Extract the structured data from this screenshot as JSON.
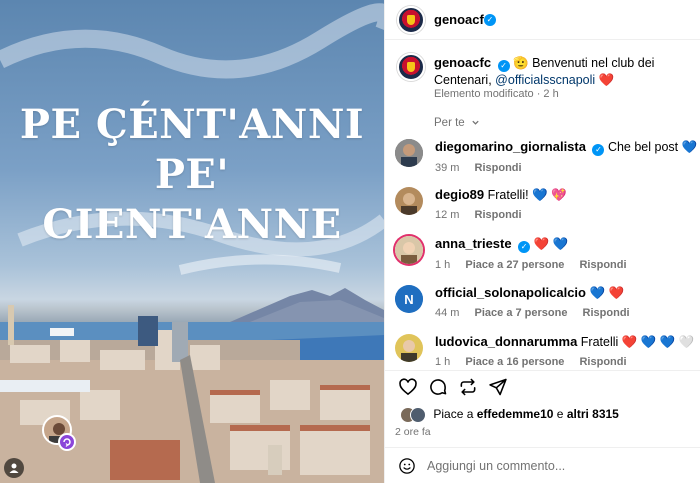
{
  "post": {
    "headline_line1": "PE ÇÉNT'ANNI",
    "headline_line2": "PE' CIENT'ANNE",
    "colors": {
      "accent_purple": "#8b45d9",
      "verified": "#0095f6"
    }
  },
  "header": {
    "username": "genoacfc",
    "verified_icon": "verified-badge-icon"
  },
  "caption": {
    "username": "genoacfc",
    "emoji": "🫡",
    "text": "Benvenuti nel club dei Centenari,",
    "mention": "@officialsscnapoli",
    "emoji_end": "❤️",
    "meta": "Elemento modificato · 2 h"
  },
  "sort": {
    "label": "Per te",
    "chevron": "chevron-down-icon"
  },
  "comments": [
    {
      "user": "diegomarino_giornalista",
      "verified": true,
      "text": "Che bel post",
      "emojis": "💙",
      "time": "39 m",
      "likes": "",
      "reply": "Rispondi"
    },
    {
      "user": "degio89",
      "verified": false,
      "text": "Fratelli!",
      "emojis": "💙 💖",
      "time": "12 m",
      "likes": "",
      "reply": "Rispondi"
    },
    {
      "user": "anna_trieste",
      "verified": true,
      "text": "",
      "emojis": "❤️ 💙",
      "time": "1 h",
      "likes": "Piace a 27 persone",
      "reply": "Rispondi"
    },
    {
      "user": "official_solonapolicalcio",
      "verified": false,
      "text": "",
      "emojis": "💙 ❤️",
      "time": "44 m",
      "likes": "Piace a 7 persone",
      "reply": "Rispondi"
    },
    {
      "user": "ludovica_donnarumma",
      "verified": false,
      "text": "Fratelli",
      "emojis": "❤️ 💙 💙 🤍",
      "time": "1 h",
      "likes": "Piace a 16 persone",
      "reply": "Rispondi"
    }
  ],
  "likes_line": {
    "prefix": "Piace a",
    "user": "effedemme10",
    "conj": "e",
    "others": "altri 8315"
  },
  "timestamp": "2 ore fa",
  "add_comment": {
    "placeholder": "Aggiungi un commento..."
  }
}
